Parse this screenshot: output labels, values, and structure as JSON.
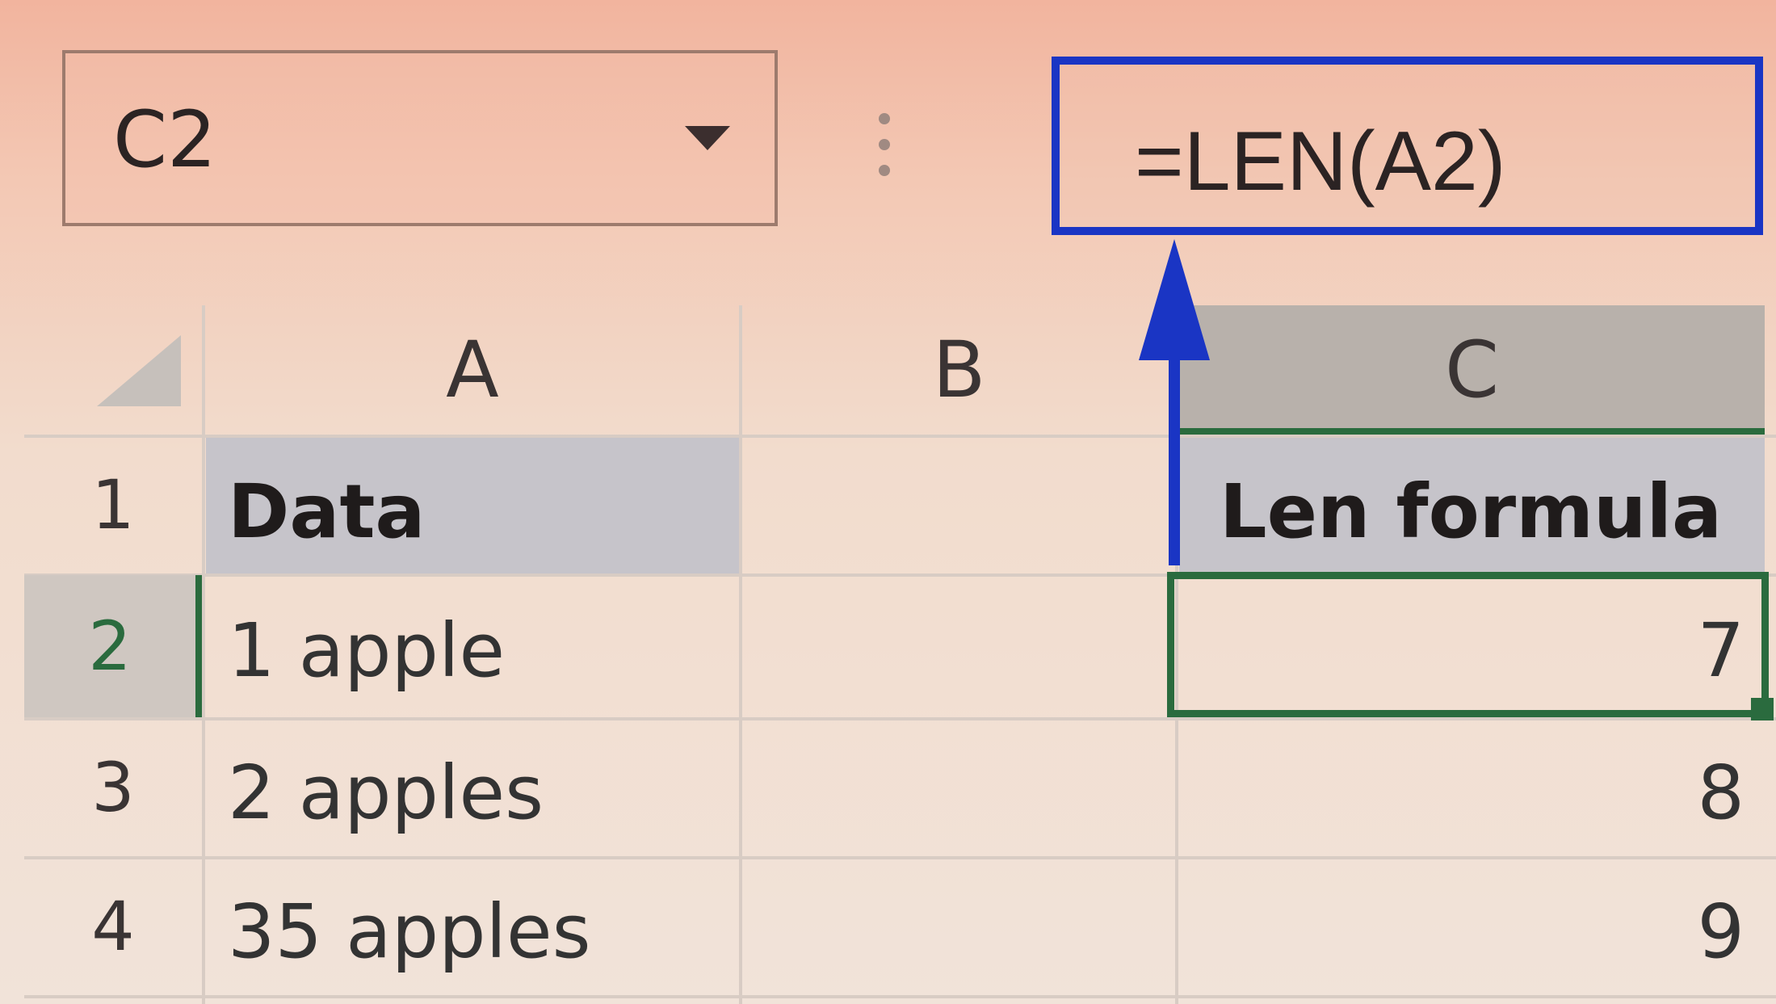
{
  "name_box": {
    "value": "C2",
    "dropdown_icon": "chevron-down-icon"
  },
  "separator_icon": "vertical-ellipsis-icon",
  "formula_bar": {
    "formula": "=LEN(A2)"
  },
  "columns": [
    "A",
    "B",
    "C"
  ],
  "rows": [
    {
      "number": "1",
      "a": "Data",
      "b": "",
      "c": "Len formula"
    },
    {
      "number": "2",
      "a": "1 apple",
      "b": "",
      "c": "7"
    },
    {
      "number": "3",
      "a": "2 apples",
      "b": "",
      "c": "8"
    },
    {
      "number": "4",
      "a": "35 apples",
      "b": "",
      "c": "9"
    }
  ],
  "selected_cell": "C2",
  "colors": {
    "selection": "#2a6b3e",
    "annotation": "#1a35c4",
    "header_fill": "#c6c4ca"
  }
}
